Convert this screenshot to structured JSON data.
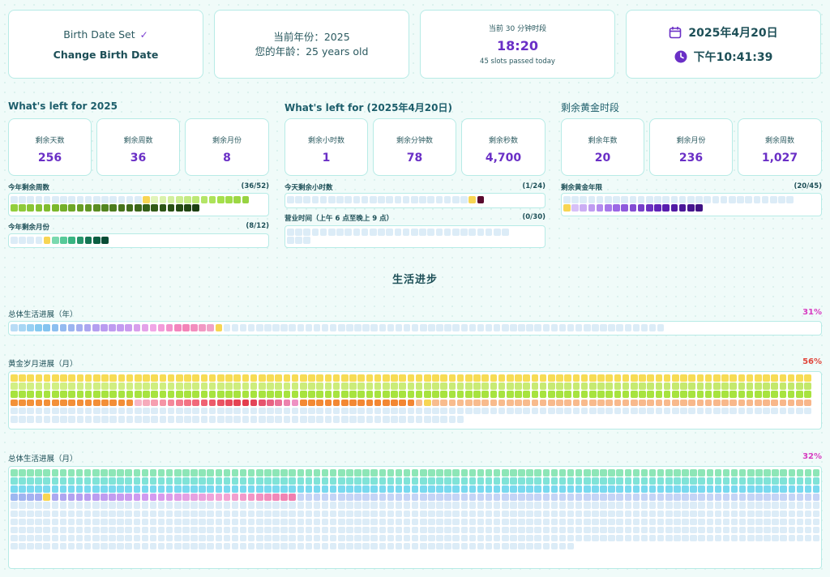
{
  "header": {
    "birth": {
      "status": "Birth Date Set",
      "action": "Change Birth Date"
    },
    "age": {
      "year_line": "当前年份：2025",
      "age_line": "您的年龄：25 years old"
    },
    "slot": {
      "title": "当前 30 分钟时段",
      "time": "18:20",
      "note": "45 slots passed today"
    },
    "datetime": {
      "date": "2025年4月20日",
      "time": "下午10:41:39"
    }
  },
  "sections": {
    "year": {
      "title": "What's left for 2025",
      "stats": [
        {
          "label": "剩余天数",
          "value": "256"
        },
        {
          "label": "剩余周数",
          "value": "36"
        },
        {
          "label": "剩余月份",
          "value": "8"
        }
      ],
      "weeks_bar": {
        "label": "今年剩余周数",
        "count": "(36/52)",
        "total": 52,
        "passed": 16
      },
      "months_bar": {
        "label": "今年剩余月份",
        "count": "(8/12)",
        "total": 12,
        "passed": 4
      }
    },
    "day": {
      "title": "What's left for (2025年4月20日)",
      "stats": [
        {
          "label": "剩余小时数",
          "value": "1"
        },
        {
          "label": "剩余分钟数",
          "value": "78"
        },
        {
          "label": "剩余秒数",
          "value": "4,700"
        }
      ],
      "hours_bar": {
        "label": "今天剩余小时数",
        "count": "(1/24)",
        "total": 24,
        "passed": 23
      },
      "business_bar": {
        "label": "营业时间（上午 6 点至晚上 9 点）",
        "count": "(0/30)",
        "total": 30,
        "passed": 30
      }
    },
    "golden": {
      "title": "剩余黄金时段",
      "stats": [
        {
          "label": "剩余年数",
          "value": "20"
        },
        {
          "label": "剩余月份",
          "value": "236"
        },
        {
          "label": "剩余周数",
          "value": "1,027"
        }
      ],
      "years_bar": {
        "label": "剩余黄金年限",
        "count": "(20/45)",
        "total": 45,
        "passed": 25
      }
    }
  },
  "life": {
    "title": "生活进步",
    "overall_years": {
      "label": "总体生活进展（年）",
      "percent": "31%",
      "total": 80,
      "passed": 25
    },
    "golden_months": {
      "label": "黄金岁月进展（月）",
      "percent": "56%",
      "total": 540,
      "passed": 300
    },
    "overall_months": {
      "label": "总体生活进展（月）",
      "percent": "32%",
      "total": 960,
      "passed": 300
    }
  },
  "colors": {
    "accent": "#6a2fc6",
    "current": "#f7d553",
    "empty": "#dcecf7",
    "golden_pct": "#e0463b",
    "overall_pct": "#d63bc0"
  },
  "icons": {
    "check": "check-icon",
    "calendar": "calendar-icon",
    "clock": "clock-icon"
  }
}
